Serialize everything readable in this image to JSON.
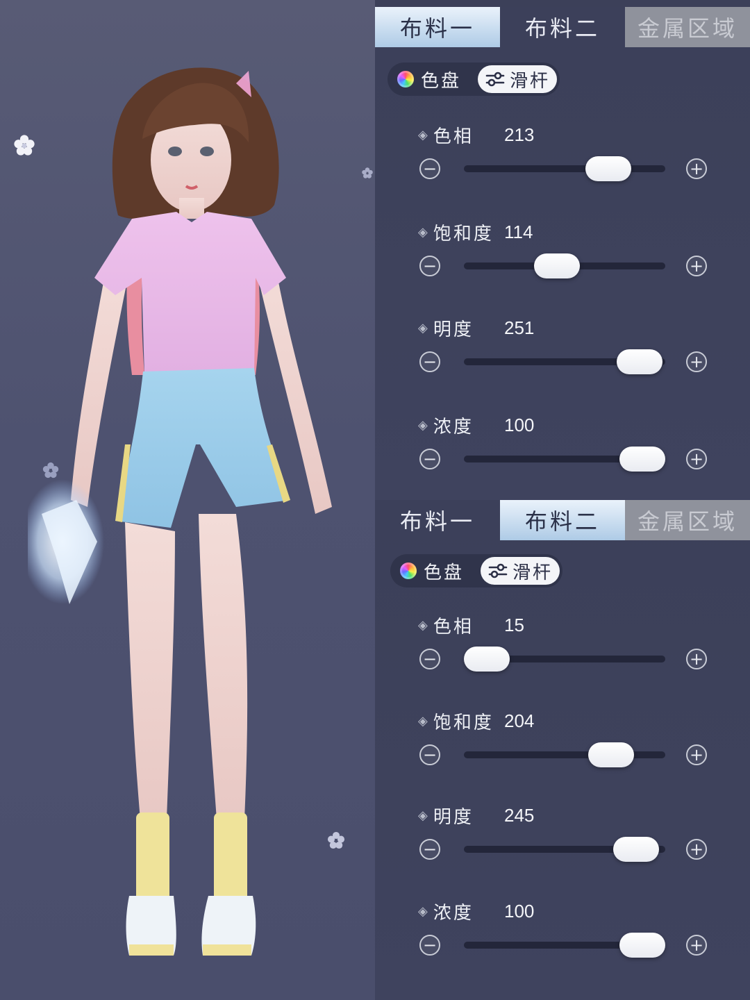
{
  "panels": [
    {
      "tabs": [
        {
          "label": "布料一",
          "state": "active"
        },
        {
          "label": "布料二",
          "state": "inactive"
        },
        {
          "label": "金属区域",
          "state": "disabled"
        }
      ],
      "mode": {
        "palette_label": "色盘",
        "slider_label": "滑杆",
        "selected": "滑杆"
      },
      "sliders": [
        {
          "label": "色相",
          "value": "213",
          "fraction": 0.78
        },
        {
          "label": "饱和度",
          "value": "114",
          "fraction": 0.45
        },
        {
          "label": "明度",
          "value": "251",
          "fraction": 0.98
        },
        {
          "label": "浓度",
          "value": "100",
          "fraction": 1.0
        }
      ]
    },
    {
      "tabs": [
        {
          "label": "布料一",
          "state": "inactive"
        },
        {
          "label": "布料二",
          "state": "active"
        },
        {
          "label": "金属区域",
          "state": "disabled"
        }
      ],
      "mode": {
        "palette_label": "色盘",
        "slider_label": "滑杆",
        "selected": "滑杆"
      },
      "sliders": [
        {
          "label": "色相",
          "value": "15",
          "fraction": 0.0
        },
        {
          "label": "饱和度",
          "value": "204",
          "fraction": 0.8
        },
        {
          "label": "明度",
          "value": "245",
          "fraction": 0.96
        },
        {
          "label": "浓度",
          "value": "100",
          "fraction": 1.0
        }
      ]
    }
  ],
  "icons": {
    "palette": "color-wheel-icon",
    "slider": "slider-settings-icon",
    "decrease": "minus-circle-icon",
    "increase": "plus-circle-icon",
    "bullet": "diamond-icon"
  },
  "colors": {
    "panel_bg": "#3e425c",
    "tab_active": "#c8dcef",
    "tab_disabled": "#8f929c",
    "track": "#23263a",
    "knob": "#ffffff"
  }
}
